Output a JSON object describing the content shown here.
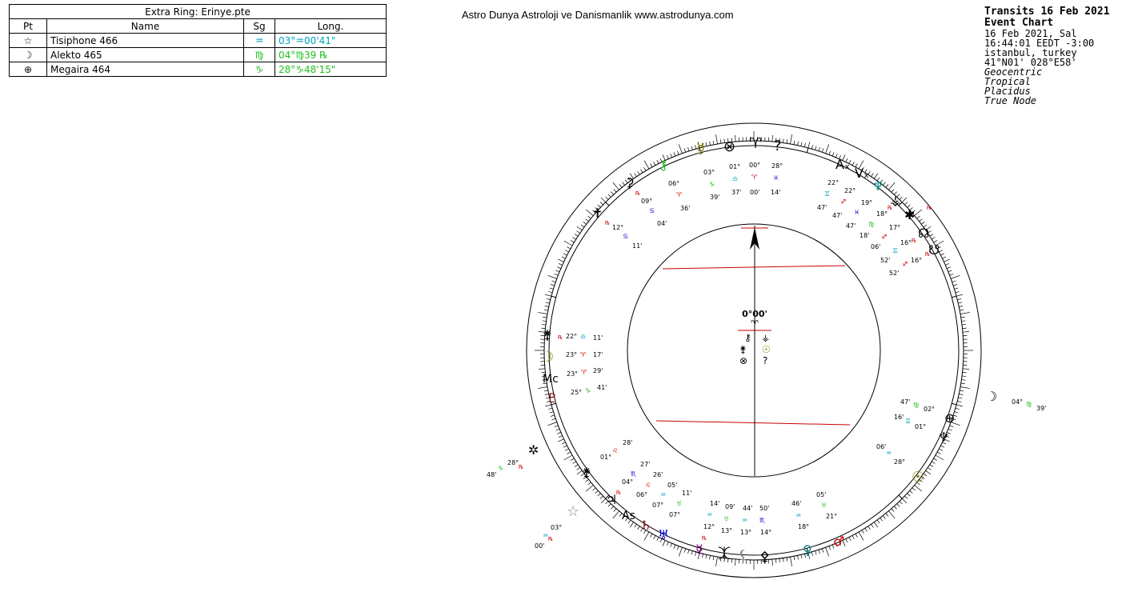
{
  "extra_ring": {
    "title": "Extra Ring: Erinye.pte",
    "headers": {
      "pt": "Pt",
      "name": "Name",
      "sg": "Sg",
      "long": "Long."
    },
    "rows": [
      {
        "pt": "☆",
        "name": "Tisiphone 466",
        "sg": "♒",
        "long": "03°♒00'41\"",
        "color": "#00a0c0"
      },
      {
        "pt": "☽",
        "name": "Alekto 465",
        "sg": "♍",
        "long": "04°♍39 ℞",
        "color": "#20c020"
      },
      {
        "pt": "⊕",
        "name": "Megaira 464",
        "sg": "♑",
        "long": "28°♑48'15\"",
        "color": "#20c020"
      }
    ]
  },
  "header_site": "Astro Dunya Astroloji ve Danismanlik www.astrodunya.com",
  "chart_info": {
    "title": "Transits 16 Feb 2021",
    "subtitle": "Event Chart",
    "date": "16 Feb 2021, Sal",
    "time": "16:44:01  EEDT -3:00",
    "place": "istanbul, turkey",
    "coords": "41°N01' 028°E58'",
    "settings": [
      "Geocentric",
      "Tropical",
      "Placidus",
      "True Node"
    ]
  },
  "center": {
    "degree": "0°00'",
    "sign": "♈"
  },
  "colors": {
    "red": "#cc0000",
    "cyan": "#00a0c0",
    "green": "#20c020",
    "blue": "#0000cc",
    "olive": "#808000",
    "maroon": "#800000",
    "purple": "#800080",
    "teal": "#008080"
  },
  "outer_labels": [
    {
      "glyph": "♀",
      "deg": "03°",
      "sign": "♑",
      "min": "39'",
      "sc": "#20c020"
    },
    {
      "glyph": "⊗",
      "deg": "01°",
      "sign": "♎",
      "min": "37'",
      "sc": "#00a0c0"
    },
    {
      "glyph": "♈",
      "deg": "00°",
      "sign": "♈",
      "min": "00'",
      "sc": "#cc0000"
    },
    {
      "glyph": "?",
      "deg": "28°",
      "sign": "♓",
      "min": "14'",
      "sc": "#0000cc"
    }
  ]
}
